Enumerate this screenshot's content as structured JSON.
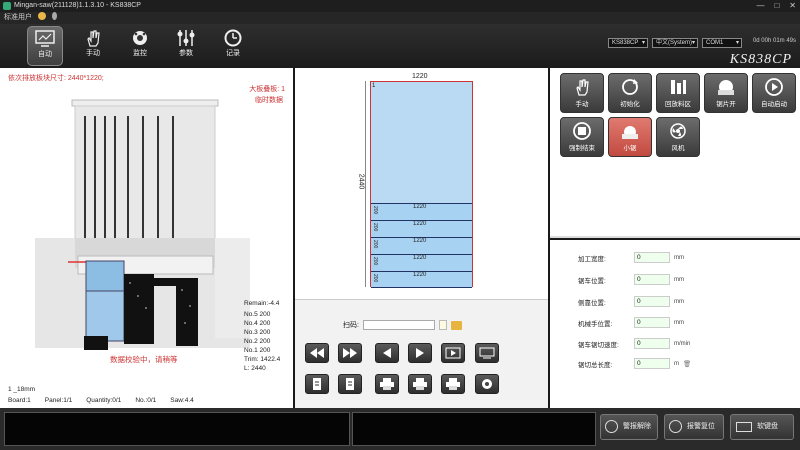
{
  "window": {
    "title": "Mingan-saw(211128)1.1.3.10 - KS838CP",
    "min": "—",
    "max": "□",
    "close": "✕"
  },
  "user": {
    "label": "标准用户"
  },
  "nav": [
    {
      "label": "自动",
      "icon": "monitor-icon"
    },
    {
      "label": "手动",
      "icon": "hand-icon"
    },
    {
      "label": "监控",
      "icon": "gear-icon"
    },
    {
      "label": "参数",
      "icon": "sliders-icon"
    },
    {
      "label": "记录",
      "icon": "clock-icon"
    }
  ],
  "selectors": {
    "model": "KS838CP",
    "language": "中文(System)",
    "port": "COM1"
  },
  "timer": "0d 00h 01m 49s",
  "model_badge": "KS838CP",
  "left": {
    "next_size": "依次排放板块尺寸: 2440*1220;",
    "big_board_label": "大板叠板: 1",
    "temp_data": "临时数据",
    "remain": "Remain:-4.4",
    "rows": [
      "No.5  200",
      "No.4  200",
      "No.3  200",
      "No.2  200",
      "No.1  200"
    ],
    "trim": "Trim:   1422.4",
    "length": "L:  2440",
    "status": "数据校验中，请稍等",
    "thickness": "1  _18mm",
    "board": "Board:1",
    "panel": "Panel:1/1",
    "quantity": "Quantity:0/1",
    "no": "No.:0/1",
    "saw": "Saw:4.4"
  },
  "center": {
    "top_width": "1220",
    "side_length": "2440",
    "marker": "1",
    "strips": [
      {
        "height": "200",
        "width": "1220"
      },
      {
        "height": "200",
        "width": "1220"
      },
      {
        "height": "200",
        "width": "1220"
      },
      {
        "height": "200",
        "width": "1220"
      },
      {
        "height": "200",
        "width": "1220"
      }
    ],
    "scan_label": "扫码:"
  },
  "actions": [
    {
      "label": "手动",
      "icon": "hand-icon"
    },
    {
      "label": "初始化",
      "icon": "refresh-icon"
    },
    {
      "label": "回放料区",
      "icon": "bars-icon"
    },
    {
      "label": "锯片开",
      "icon": "saw-icon"
    },
    {
      "label": "自动启动",
      "icon": "play-icon"
    },
    {
      "label": "强制结束",
      "icon": "stop-icon"
    },
    {
      "label": "小锯",
      "icon": "small-saw-icon",
      "active": true
    },
    {
      "label": "风机",
      "icon": "fan-icon"
    }
  ],
  "params": [
    {
      "label": "加工宽度:",
      "value": "0",
      "unit": "mm"
    },
    {
      "label": "锯车位置:",
      "value": "0",
      "unit": "mm"
    },
    {
      "label": "侧靠位置:",
      "value": "0",
      "unit": "mm"
    },
    {
      "label": "机械手位置:",
      "value": "0",
      "unit": "mm"
    },
    {
      "label": "锯车锯切速度:",
      "value": "0",
      "unit": "m/min"
    },
    {
      "label": "锯切总长度:",
      "value": "0",
      "unit": "m"
    }
  ],
  "status_buttons": {
    "alarm_clear": "警报解除",
    "reset": "报警复位",
    "keyboard": "软键盘"
  }
}
